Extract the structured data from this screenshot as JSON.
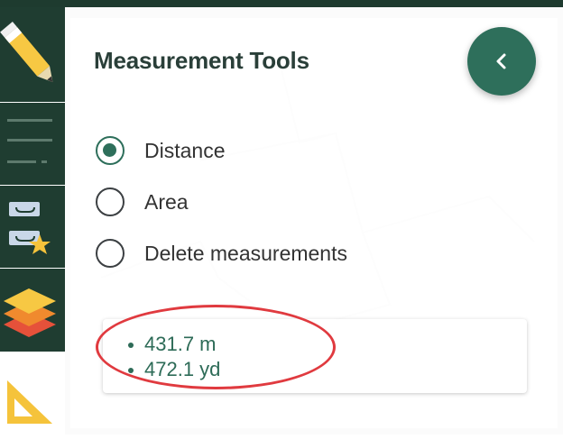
{
  "panel": {
    "title": "Measurement Tools",
    "back_button_icon": "chevron-left-icon"
  },
  "options": [
    {
      "label": "Distance",
      "checked": true
    },
    {
      "label": "Area",
      "checked": false
    },
    {
      "label": "Delete measurements",
      "checked": false
    }
  ],
  "results": [
    {
      "value": "431.7 m"
    },
    {
      "value": "472.1 yd"
    }
  ],
  "sidebar": {
    "tools": [
      "pencil-icon",
      "legend-list-icon",
      "bookmarks-star-icon",
      "layers-icon",
      "ruler-triangle-icon"
    ]
  },
  "colors": {
    "sidebar": "#1f3d31",
    "accent": "#2e6f5b",
    "annotation": "#e03a3f"
  }
}
